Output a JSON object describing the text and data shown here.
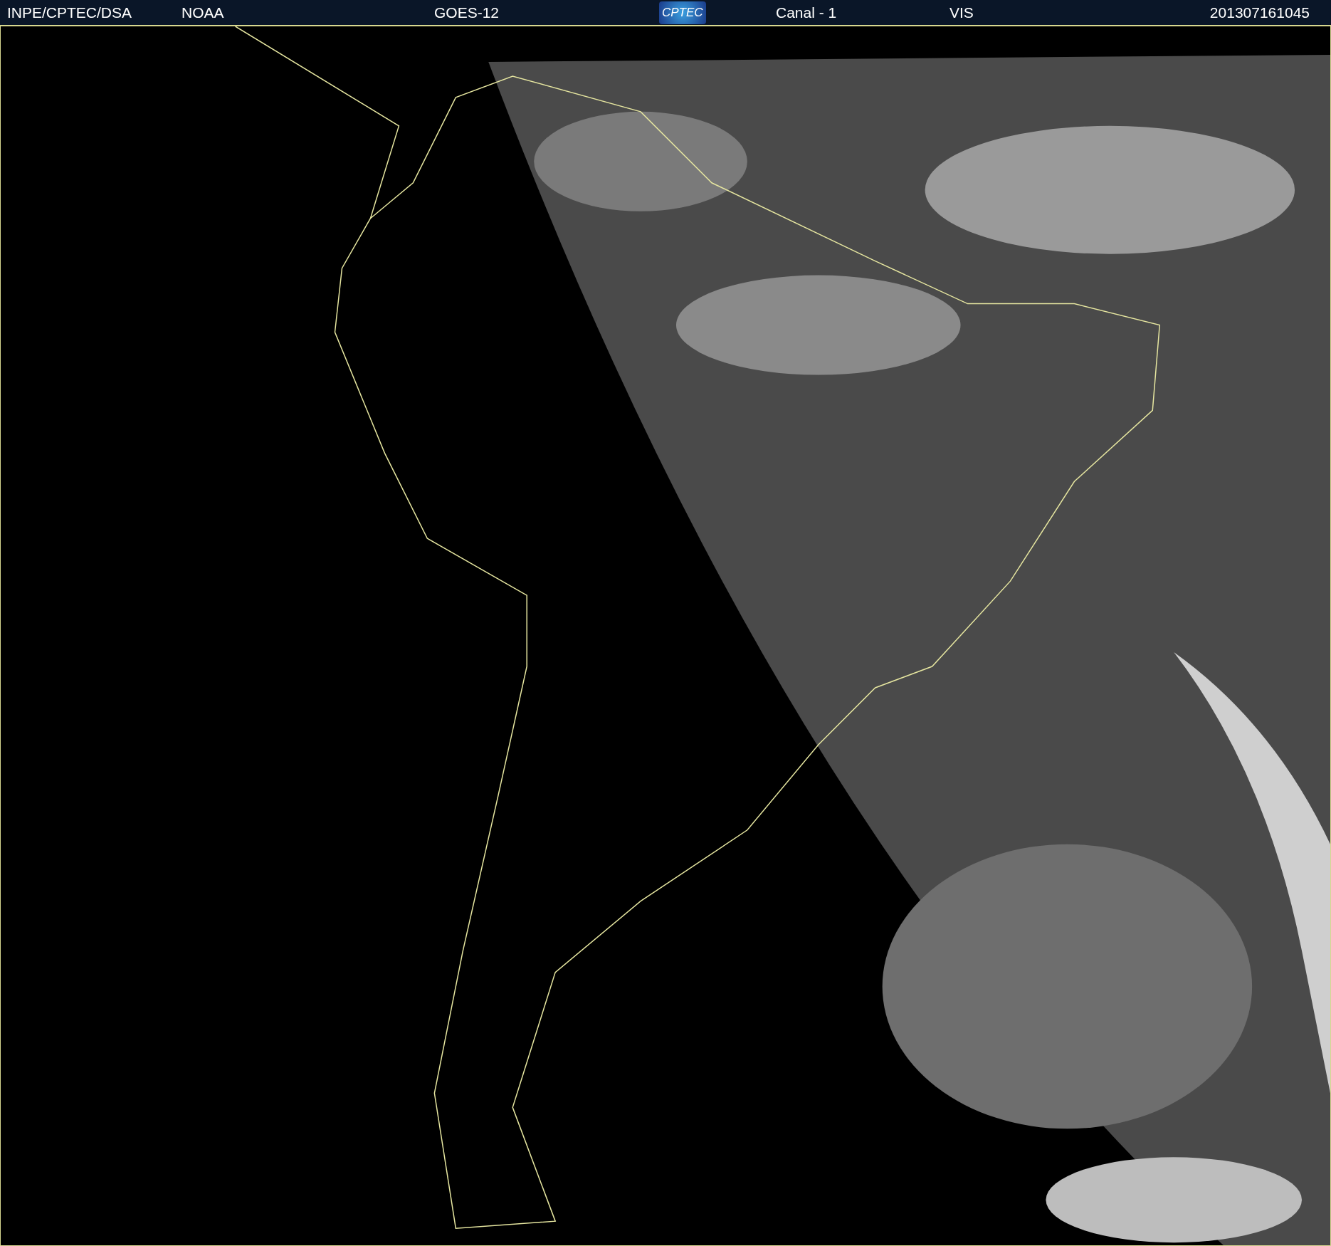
{
  "header": {
    "items": [
      {
        "kind": "text",
        "text": "INPE/CPTEC/DSA"
      },
      {
        "kind": "text",
        "text": "NOAA"
      },
      {
        "kind": "text",
        "text": "GOES-12"
      },
      {
        "kind": "logo",
        "text": "CPTEC"
      },
      {
        "kind": "text",
        "text": "Canal - 1"
      },
      {
        "kind": "text",
        "text": "VIS"
      },
      {
        "kind": "text",
        "text": "201307161045"
      }
    ]
  }
}
